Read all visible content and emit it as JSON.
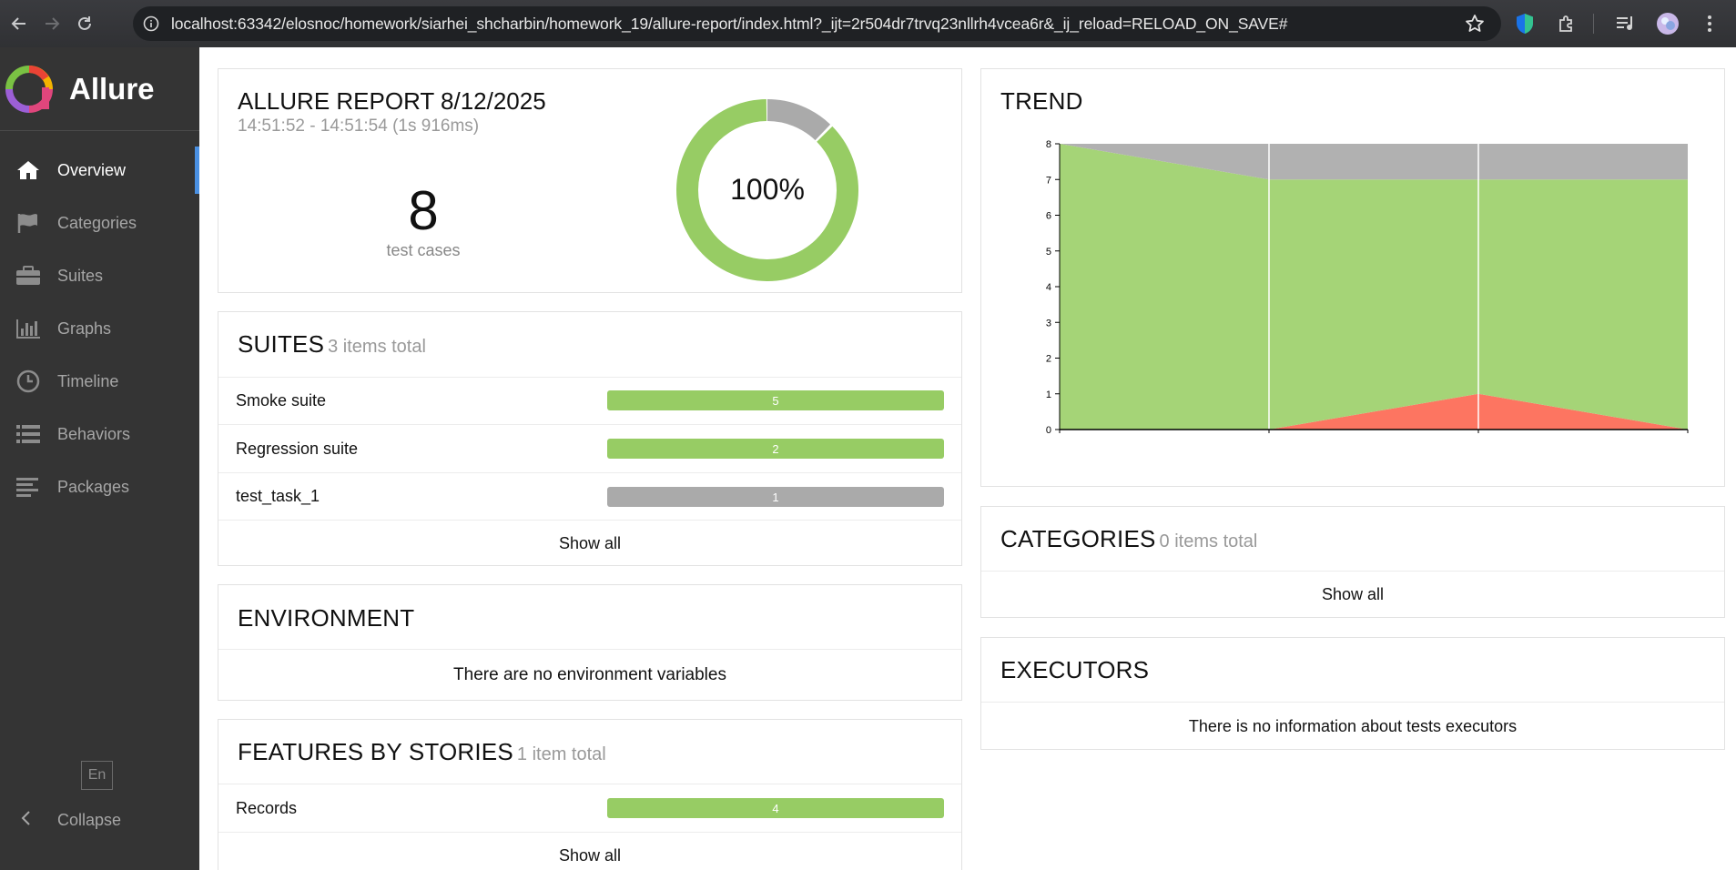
{
  "browser": {
    "url": "localhost:63342/elosnoc/homework/siarhei_shcharbin/homework_19/allure-report/index.html?_ijt=2r504dr7trvq23nllrh4vcea6r&_ij_reload=RELOAD_ON_SAVE#"
  },
  "sidebar": {
    "brand": "Allure",
    "items": [
      {
        "label": "Overview",
        "icon": "home-icon"
      },
      {
        "label": "Categories",
        "icon": "flag-icon"
      },
      {
        "label": "Suites",
        "icon": "briefcase-icon"
      },
      {
        "label": "Graphs",
        "icon": "bar-chart-icon"
      },
      {
        "label": "Timeline",
        "icon": "clock-icon"
      },
      {
        "label": "Behaviors",
        "icon": "list-icon"
      },
      {
        "label": "Packages",
        "icon": "align-left-icon"
      }
    ],
    "language": "En",
    "collapse_label": "Collapse"
  },
  "summary": {
    "title": "ALLURE REPORT 8/12/2025",
    "time_range": "14:51:52 - 14:51:54 (1s 916ms)",
    "test_count": "8",
    "test_count_label": "test cases",
    "percent": "100%",
    "donut": {
      "passed": 7,
      "skipped": 1,
      "passed_color": "#97cc64",
      "skipped_color": "#aaaaaa"
    }
  },
  "suites": {
    "title": "SUITES",
    "count": "3 items total",
    "rows": [
      {
        "name": "Smoke suite",
        "value": "5",
        "status": "passed"
      },
      {
        "name": "Regression suite",
        "value": "2",
        "status": "passed"
      },
      {
        "name": "test_task_1",
        "value": "1",
        "status": "skipped"
      }
    ],
    "show_all": "Show all"
  },
  "environment": {
    "title": "ENVIRONMENT",
    "message": "There are no environment variables"
  },
  "features": {
    "title": "FEATURES BY STORIES",
    "count": "1 item total",
    "rows": [
      {
        "name": "Records",
        "value": "4",
        "status": "passed"
      }
    ],
    "show_all": "Show all"
  },
  "trend": {
    "title": "TREND"
  },
  "categories": {
    "title": "CATEGORIES",
    "count": "0 items total",
    "show_all": "Show all"
  },
  "executors": {
    "title": "EXECUTORS",
    "message": "There is no information about tests executors"
  },
  "chart_data": {
    "type": "area",
    "title": "",
    "x": [
      1,
      2,
      3,
      4
    ],
    "ylim": [
      0,
      8
    ],
    "yticks": [
      0,
      1,
      2,
      3,
      4,
      5,
      6,
      7,
      8
    ],
    "stacked": true,
    "series": [
      {
        "key": "failed",
        "values": [
          0,
          0,
          1,
          0
        ],
        "color": "#fd7561"
      },
      {
        "key": "passed",
        "values": [
          8,
          7,
          6,
          7
        ],
        "color": "#a5d477"
      },
      {
        "key": "skipped",
        "values": [
          0,
          1,
          1,
          1
        ],
        "color": "#b1b1b1"
      }
    ]
  }
}
